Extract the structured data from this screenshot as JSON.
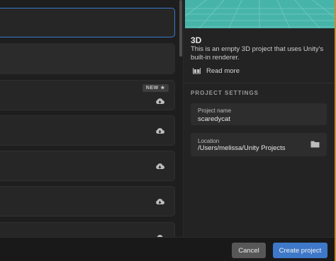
{
  "template_list": {
    "new_badge": "NEW"
  },
  "details": {
    "template_title": "3D",
    "template_description": "This is an empty 3D project that uses Unity's built-in renderer.",
    "read_more": "Read more"
  },
  "project_settings": {
    "section_title": "PROJECT SETTINGS",
    "project_name_label": "Project name",
    "project_name_value": "scaredycat",
    "location_label": "Location",
    "location_value": "/Users/melissa/Unity Projects"
  },
  "footer": {
    "cancel_label": "Cancel",
    "create_label": "Create project"
  },
  "colors": {
    "accent": "#3d78c9",
    "preview_teal": "#47b4a9"
  },
  "icons": [
    "cloud-download-icon",
    "star-icon",
    "book-icon",
    "folder-icon"
  ]
}
